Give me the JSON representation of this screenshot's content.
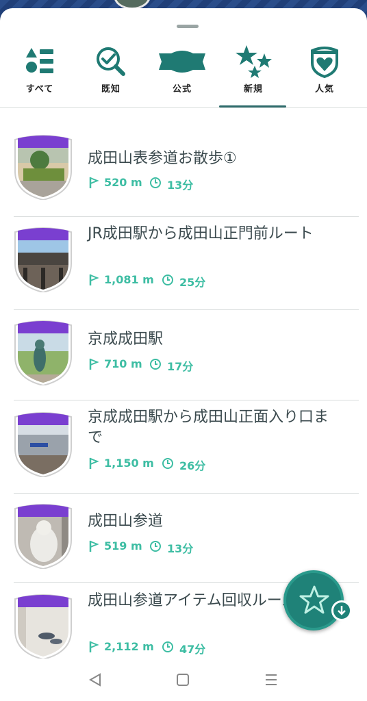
{
  "tabs": [
    {
      "label": "すべて",
      "icon": "list-icon",
      "active": false
    },
    {
      "label": "既知",
      "icon": "magnifier-check-icon",
      "active": false
    },
    {
      "label": "公式",
      "icon": "official-banner-icon",
      "active": false
    },
    {
      "label": "新規",
      "icon": "three-stars-icon",
      "active": true
    },
    {
      "label": "人気",
      "icon": "heart-badge-icon",
      "active": false
    }
  ],
  "routes": [
    {
      "title": "成田山表参道お散歩①",
      "distance": "520 m",
      "time": "13分"
    },
    {
      "title": "JR成田駅から成田山正門前ルート",
      "distance": "1,081 m",
      "time": "25分"
    },
    {
      "title": "京成成田駅",
      "distance": "710 m",
      "time": "17分"
    },
    {
      "title": "京成成田駅から成田山正面入り口まで",
      "distance": "1,150 m",
      "time": "26分"
    },
    {
      "title": "成田山参道",
      "distance": "519 m",
      "time": "13分"
    },
    {
      "title": "成田山参道アイテム回収ルース",
      "distance": "2,112 m",
      "time": "47分"
    }
  ],
  "fab": {
    "icon": "star-download-icon"
  },
  "navbar": {
    "back": "back-triangle-icon",
    "home": "home-square-icon",
    "menu": "menu-lines-icon"
  },
  "colors": {
    "accent": "#3dbda3",
    "icon_teal": "#1f7a73",
    "badge_purple": "#7a3fd0",
    "title_text": "#3b4a4e"
  }
}
